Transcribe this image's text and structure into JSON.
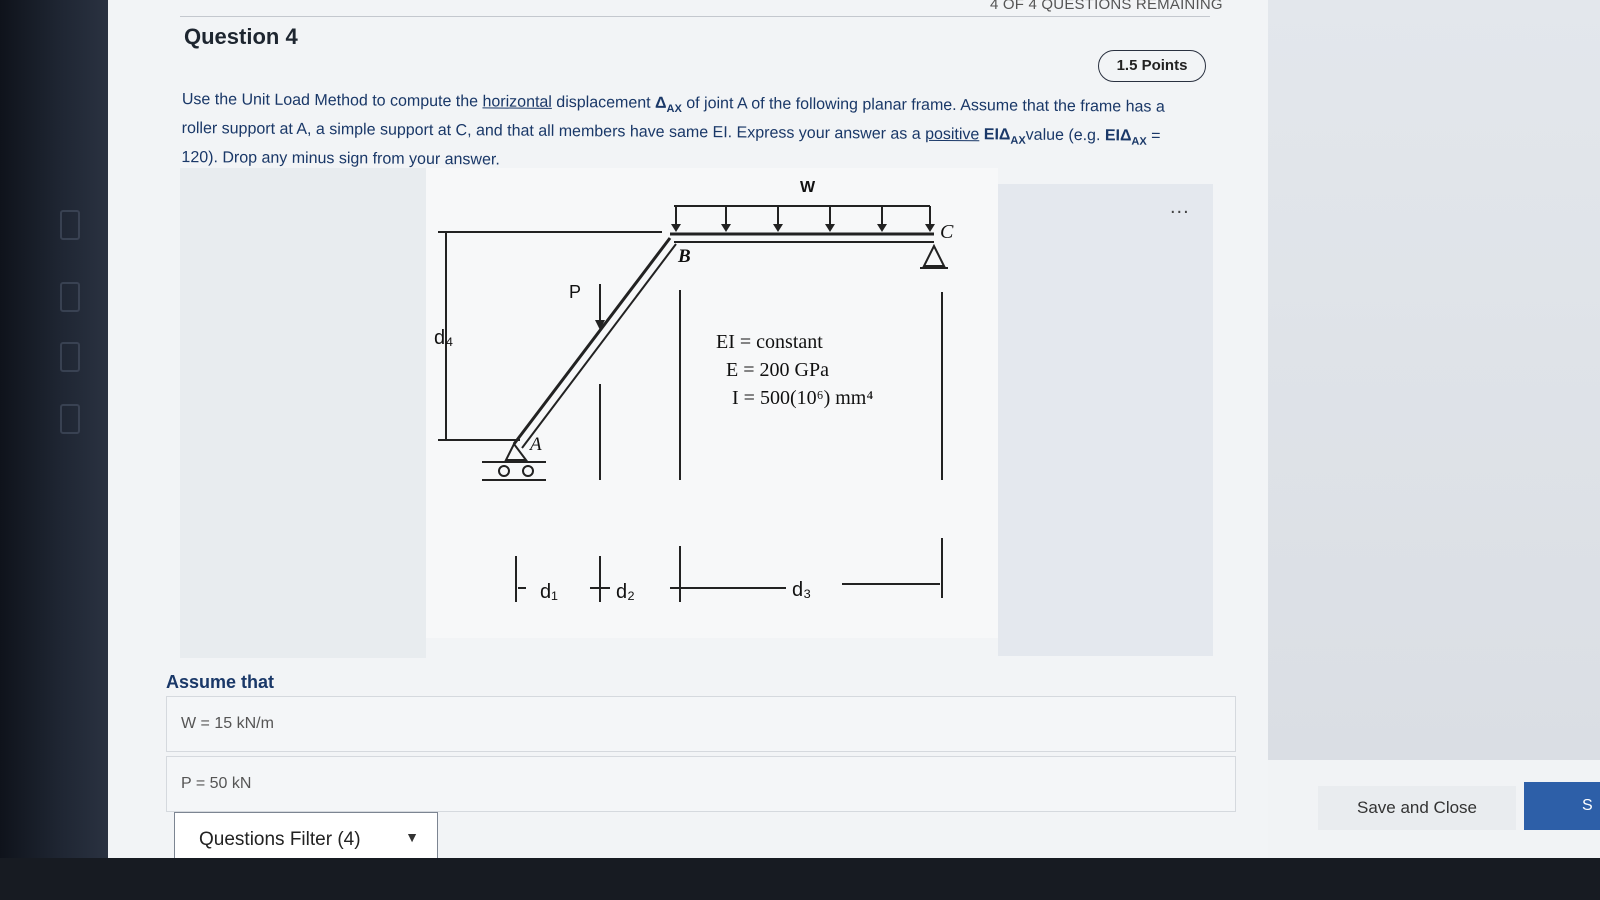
{
  "header": {
    "remaining": "4 OF 4 QUESTIONS REMAINING",
    "question_title": "Question 4",
    "points": "1.5 Points"
  },
  "prompt": {
    "t1": "Use the Unit Load Method to compute the ",
    "horizontal": "horizontal",
    "t2": " displacement ",
    "delta": "Δ",
    "ax": "AX",
    "t3": " of joint A of the following planar frame. Assume that the frame has a roller support at A, a simple support at C, and that all members have same EI. Express your answer as a ",
    "positive": "positive",
    "ei_delta": "EIΔ",
    "t4": "value (e.g. ",
    "example_value": " = 120). Drop any minus sign from your answer."
  },
  "figure": {
    "load_w": "W",
    "load_p": "P",
    "joint_a": "A",
    "joint_b": "B",
    "joint_c": "C",
    "dim_d1": "d₁",
    "dim_d2": "d₂",
    "dim_d3": "d₃",
    "dim_d4": "d₄",
    "prop_ei": "EI = constant",
    "prop_e": "E = 200 GPa",
    "prop_i": "I = 500(10⁶) mm⁴",
    "more": "..."
  },
  "assumptions": {
    "label": "Assume that",
    "w_value": "W = 15 kN/m",
    "p_value": "P = 50 kN"
  },
  "footer": {
    "filter_label": "Questions Filter (4)",
    "save_close": "Save and Close",
    "next_label": "S"
  }
}
